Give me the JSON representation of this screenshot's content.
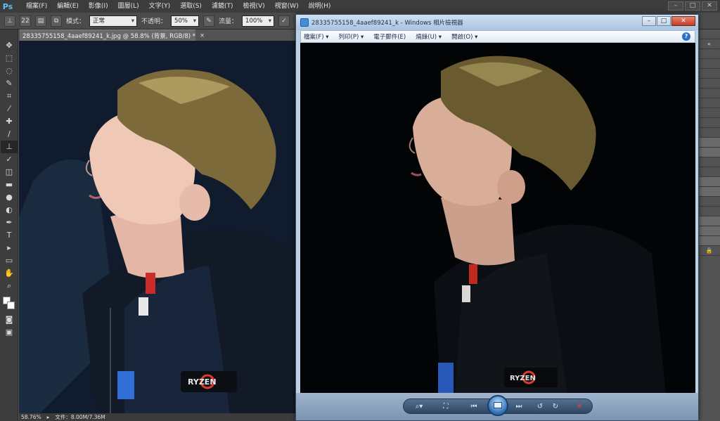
{
  "photoshop": {
    "logo": "Ps",
    "menu": [
      "檔案(F)",
      "編輯(E)",
      "影像(I)",
      "圖層(L)",
      "文字(Y)",
      "選取(S)",
      "濾鏡(T)",
      "檢視(V)",
      "視窗(W)",
      "說明(H)"
    ],
    "options": {
      "brush_size": "22",
      "mode_label": "模式：",
      "mode_value": "正常",
      "opacity_label": "不透明：",
      "opacity_value": "50%",
      "flow_label": "流量：",
      "flow_value": "100%"
    },
    "document_tab": {
      "title": "28335755158_4aaef89241_k.jpg @ 58.8% (背景, RGB/8) *",
      "close": "×"
    },
    "status": {
      "zoom": "58.76%",
      "file_size": "文件：8.00M/7.36M"
    },
    "tool_icons": [
      "move-icon",
      "marquee-icon",
      "lasso-icon",
      "quick-select-icon",
      "crop-icon",
      "eyedropper-icon",
      "healing-icon",
      "brush-icon",
      "clone-stamp-icon",
      "history-brush-icon",
      "eraser-icon",
      "gradient-icon",
      "blur-icon",
      "dodge-icon",
      "pen-icon",
      "type-icon",
      "path-select-icon",
      "shape-icon",
      "hand-icon",
      "zoom-icon"
    ],
    "tool_glyphs": [
      "✥",
      "⬚",
      "◌",
      "✎",
      "⌗",
      "⁄",
      "✚",
      "/",
      "⊥",
      "✓",
      "◫",
      "▬",
      "●",
      "◐",
      "✒",
      "T",
      "▸",
      "▭",
      "✋",
      "⌕"
    ],
    "foreground_color": "#ffffff",
    "background_color": "#ffffff"
  },
  "viewer": {
    "title": "28335755158_4aaef89241_k - Windows 相片檢視器",
    "menu": [
      "檔案(F) ▾",
      "列印(P) ▾",
      "電子郵件(E)",
      "燒錄(U) ▾",
      "開啟(O) ▾"
    ],
    "help": "?",
    "controls": {
      "zoom": "⌕▾",
      "fit": "⛶",
      "prev": "⏮",
      "next": "⏭",
      "rotate_ccw": "↺",
      "rotate_cw": "↻",
      "delete": "✕"
    },
    "window_buttons": {
      "min": "–",
      "max": "□",
      "close": "✕"
    }
  },
  "photo_labels": {
    "jacket_logo": "RYZEN"
  },
  "colors": {
    "ps_bg": "#535353",
    "ps_chrome": "#3c3c3c",
    "viewer_frame": "#bcd0e6",
    "accent_red": "#e0392b"
  }
}
